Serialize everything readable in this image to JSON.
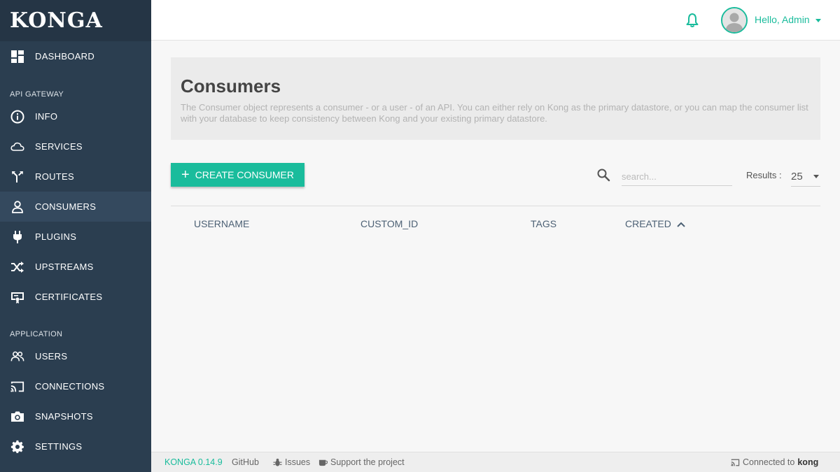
{
  "brand": "KONGA",
  "sidebar": {
    "top_items": [
      {
        "label": "DASHBOARD",
        "icon": "dashboard-icon"
      }
    ],
    "sections": [
      {
        "title": "API GATEWAY",
        "items": [
          {
            "label": "INFO",
            "icon": "info-icon"
          },
          {
            "label": "SERVICES",
            "icon": "cloud-icon"
          },
          {
            "label": "ROUTES",
            "icon": "routes-icon"
          },
          {
            "label": "CONSUMERS",
            "icon": "user-icon",
            "active": true
          },
          {
            "label": "PLUGINS",
            "icon": "plug-icon"
          },
          {
            "label": "UPSTREAMS",
            "icon": "shuffle-icon"
          },
          {
            "label": "CERTIFICATES",
            "icon": "certificate-icon"
          }
        ]
      },
      {
        "title": "APPLICATION",
        "items": [
          {
            "label": "USERS",
            "icon": "users-icon"
          },
          {
            "label": "CONNECTIONS",
            "icon": "cast-icon"
          },
          {
            "label": "SNAPSHOTS",
            "icon": "camera-icon"
          },
          {
            "label": "SETTINGS",
            "icon": "gear-icon"
          }
        ]
      }
    ]
  },
  "topbar": {
    "greeting": "Hello, Admin",
    "notification_icon": "bell-icon",
    "avatar_icon": "avatar-icon"
  },
  "page": {
    "title": "Consumers",
    "description": "The Consumer object represents a consumer - or a user - of an API. You can either rely on Kong as the primary datastore, or you can map the consumer list with your database to keep consistency between Kong and your existing primary datastore."
  },
  "toolbar": {
    "create_label": "CREATE CONSUMER",
    "search_placeholder": "search...",
    "results_label": "Results :",
    "results_value": "25"
  },
  "table": {
    "columns": [
      "USERNAME",
      "CUSTOM_ID",
      "TAGS",
      "CREATED"
    ],
    "sort_column": "CREATED",
    "rows": []
  },
  "footer": {
    "version": "KONGA 0.14.9",
    "github": "GitHub",
    "issues": "Issues",
    "support": "Support the project",
    "connected_prefix": "Connected to",
    "connected_name": "kong"
  },
  "colors": {
    "sidebar": "#2b3e50",
    "sidebar_active": "#34495e",
    "accent": "#1abc9c"
  }
}
